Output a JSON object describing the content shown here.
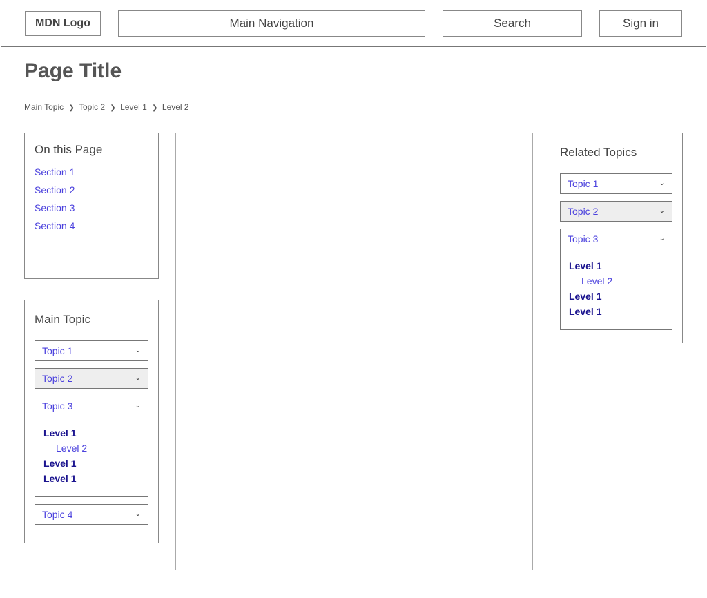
{
  "header": {
    "logo": "MDN Logo",
    "nav": "Main Navigation",
    "search": "Search",
    "signin": "Sign in"
  },
  "page": {
    "title": "Page Title"
  },
  "breadcrumbs": [
    "Main Topic",
    "Topic 2",
    "Level 1",
    "Level 2"
  ],
  "onThisPage": {
    "heading": "On this Page",
    "items": [
      "Section 1",
      "Section 2",
      "Section 3",
      "Section 4"
    ]
  },
  "mainTopic": {
    "heading": "Main Topic",
    "items": [
      {
        "label": "Topic 1",
        "shaded": false,
        "expanded": false
      },
      {
        "label": "Topic 2",
        "shaded": true,
        "expanded": false
      },
      {
        "label": "Topic 3",
        "shaded": false,
        "expanded": true,
        "children": [
          {
            "label": "Level 1",
            "level": 1
          },
          {
            "label": "Level 2",
            "level": 2
          },
          {
            "label": "Level 1",
            "level": 1
          },
          {
            "label": "Level 1",
            "level": 1
          }
        ]
      },
      {
        "label": "Topic 4",
        "shaded": false,
        "expanded": false
      }
    ]
  },
  "relatedTopics": {
    "heading": "Related Topics",
    "items": [
      {
        "label": "Topic 1",
        "shaded": false,
        "expanded": false
      },
      {
        "label": "Topic 2",
        "shaded": true,
        "expanded": false
      },
      {
        "label": "Topic 3",
        "shaded": false,
        "expanded": true,
        "children": [
          {
            "label": "Level 1",
            "level": 1
          },
          {
            "label": "Level 2",
            "level": 2
          },
          {
            "label": "Level 1",
            "level": 1
          },
          {
            "label": "Level 1",
            "level": 1
          }
        ]
      }
    ]
  }
}
